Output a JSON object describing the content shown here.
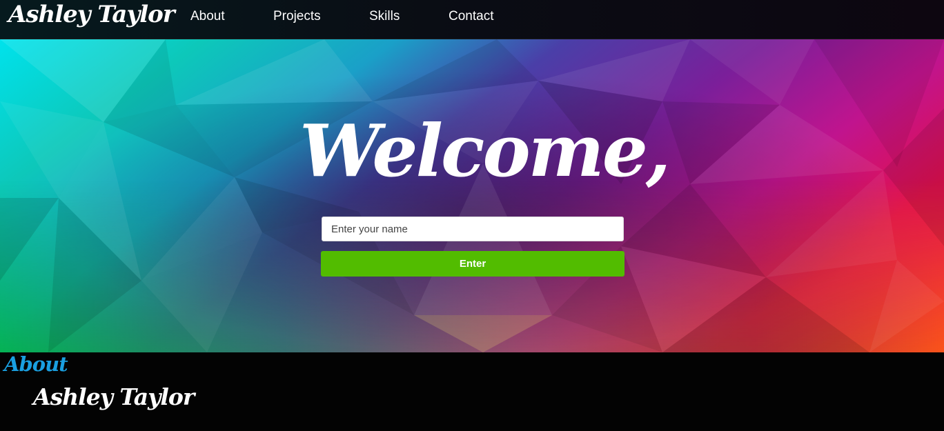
{
  "navbar": {
    "brand": "Ashley Taylor",
    "links": [
      {
        "label": "About"
      },
      {
        "label": "Projects"
      },
      {
        "label": "Skills"
      },
      {
        "label": "Contact"
      }
    ]
  },
  "hero": {
    "heading": "Welcome,",
    "name_input": {
      "placeholder": "Enter your name",
      "value": ""
    },
    "enter_button": "Enter"
  },
  "about": {
    "heading": "About",
    "name": "Ashley Taylor"
  },
  "colors": {
    "accent_green": "#52bc00",
    "about_heading_blue": "#1a9fe0",
    "footer_background": "#030303"
  }
}
